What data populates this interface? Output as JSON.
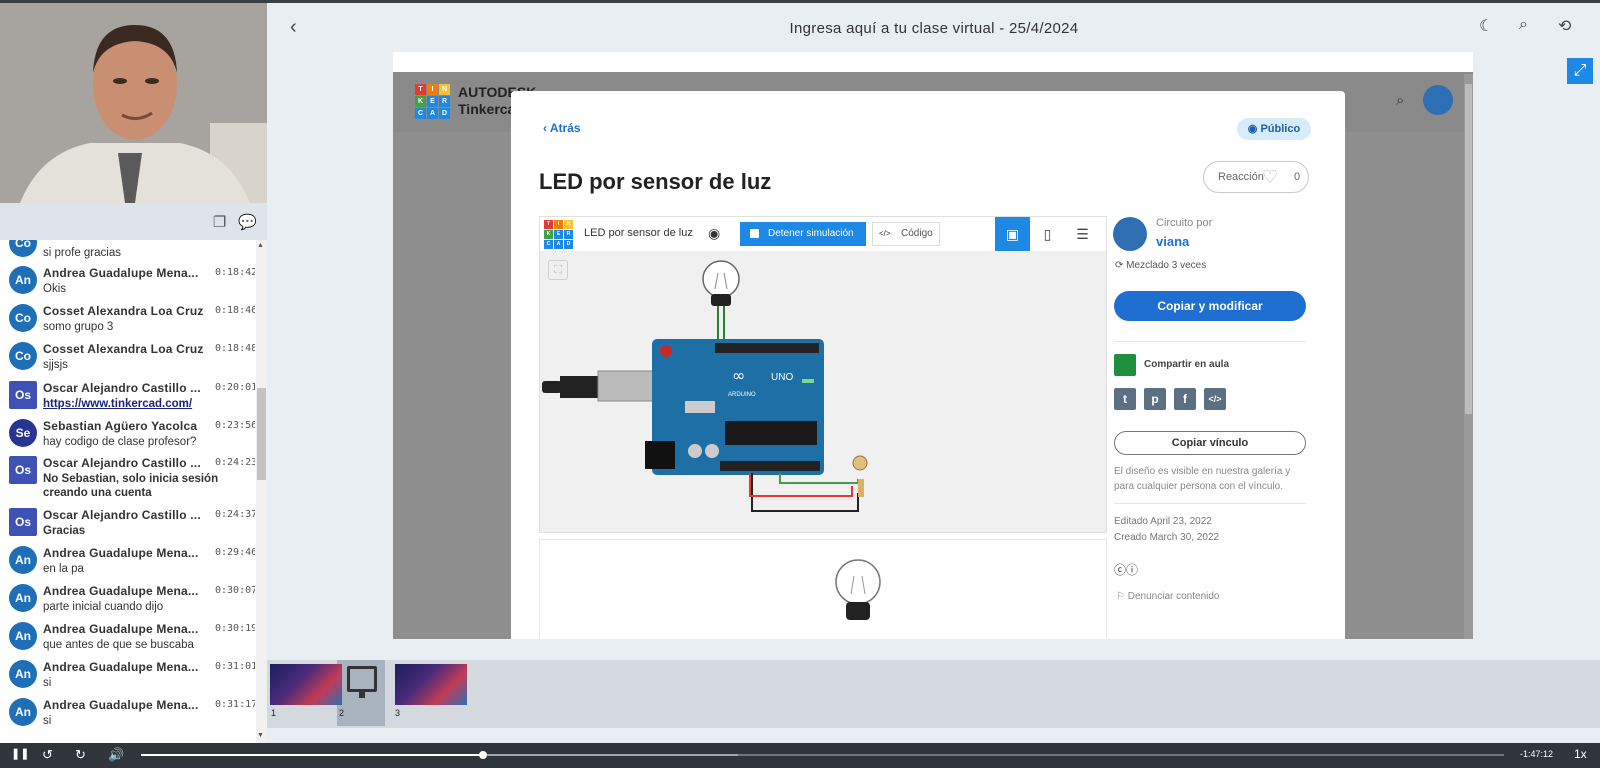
{
  "header": {
    "title": "Ingresa aquí a tu clase virtual - 25/4/2024"
  },
  "chat": {
    "messages": [
      {
        "initials": "Co",
        "name": "",
        "time": "",
        "text": "si profe gracias"
      },
      {
        "initials": "An",
        "name": "Andrea Guadalupe Mena...",
        "time": "0:18:42",
        "text": "Okis"
      },
      {
        "initials": "Co",
        "name": "Cosset Alexandra Loa Cruz",
        "time": "0:18:46",
        "text": "somo grupo 3"
      },
      {
        "initials": "Co",
        "name": "Cosset Alexandra Loa Cruz",
        "time": "0:18:48",
        "text": "sjjsjs"
      },
      {
        "initials": "Os",
        "name": "Oscar Alejandro Castillo ...",
        "time": "0:20:01",
        "text": "https://www.tinkercad.com/"
      },
      {
        "initials": "Se",
        "name": "Sebastian Agüero Yacolca",
        "time": "0:23:56",
        "text": "hay codigo de clase profesor?"
      },
      {
        "initials": "Os",
        "name": "Oscar Alejandro Castillo ...",
        "time": "0:24:23",
        "text": "No Sebastian, solo inicia sesión creando una cuenta"
      },
      {
        "initials": "Os",
        "name": "Oscar Alejandro Castillo ...",
        "time": "0:24:37",
        "text": "Gracias"
      },
      {
        "initials": "An",
        "name": "Andrea Guadalupe Mena...",
        "time": "0:29:46",
        "text": "en la pa"
      },
      {
        "initials": "An",
        "name": "Andrea Guadalupe Mena...",
        "time": "0:30:07",
        "text": "parte inicial cuando dijo"
      },
      {
        "initials": "An",
        "name": "Andrea Guadalupe Mena...",
        "time": "0:30:19",
        "text": "que antes de que se buscaba"
      },
      {
        "initials": "An",
        "name": "Andrea Guadalupe Mena...",
        "time": "0:31:01",
        "text": "si"
      },
      {
        "initials": "An",
        "name": "Andrea Guadalupe Mena...",
        "time": "0:31:17",
        "text": "si"
      }
    ]
  },
  "tinkercad": {
    "logo_letters": [
      "T",
      "I",
      "N",
      "K",
      "E",
      "R",
      "C",
      "A",
      "D"
    ],
    "logo_colors": [
      "#e53935",
      "#f57c00",
      "#fbc02d",
      "#43a047",
      "#1e88e5",
      "#1e88e5",
      "#1e88e5",
      "#1e88e5",
      "#1e88e5"
    ],
    "brand_line1": "AUTODESK",
    "brand_line2": "Tinkercad",
    "back_label": "Atrás",
    "visibility": "Público",
    "project_title": "LED por sensor de luz",
    "reaction_label": "Reacción",
    "reaction_count": "0",
    "sim_name": "LED por sensor de luz",
    "stop_sim": "Detener simulación",
    "code_label": "Código",
    "circuit_by": "Circuito por",
    "author": "viana",
    "remixed": "Mezclado 3 veces",
    "copy_modify": "Copiar y modificar",
    "share_classroom": "Compartir en aula",
    "copy_link": "Copiar vínculo",
    "description": "El diseño es visible en nuestra galería y para cualquier persona con el vínculo.",
    "edited": "Editado April 23, 2022",
    "created": "Creado March 30, 2022",
    "report": "Denunciar contenido",
    "board_brand": "ARDUINO",
    "board_model": "UNO"
  },
  "thumbnails": [
    {
      "num": "1"
    },
    {
      "num": "2"
    },
    {
      "num": "3"
    }
  ],
  "player": {
    "remaining": "-1:47:12",
    "speed": "1x",
    "progress_fraction": 0.251
  },
  "colors": {
    "accent": "#1e88e5",
    "player_bg": "#2f353b"
  }
}
